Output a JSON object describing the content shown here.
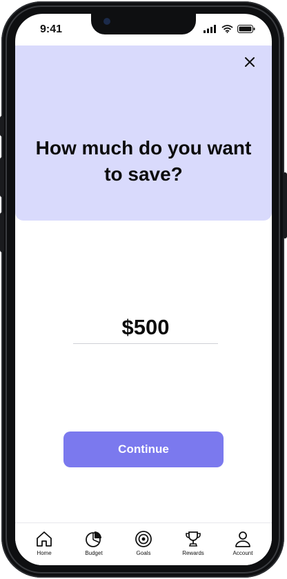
{
  "status": {
    "time": "9:41"
  },
  "header": {
    "question": "How much do you want to save?"
  },
  "amount": {
    "value": "$500"
  },
  "actions": {
    "continue_label": "Continue"
  },
  "tabs": [
    {
      "label": "Home",
      "icon": "home-icon"
    },
    {
      "label": "Budget",
      "icon": "pie-chart-icon"
    },
    {
      "label": "Goals",
      "icon": "target-icon"
    },
    {
      "label": "Rewards",
      "icon": "trophy-icon"
    },
    {
      "label": "Account",
      "icon": "person-icon"
    }
  ],
  "colors": {
    "header_bg": "#d9dafc",
    "accent": "#7b79ee"
  }
}
